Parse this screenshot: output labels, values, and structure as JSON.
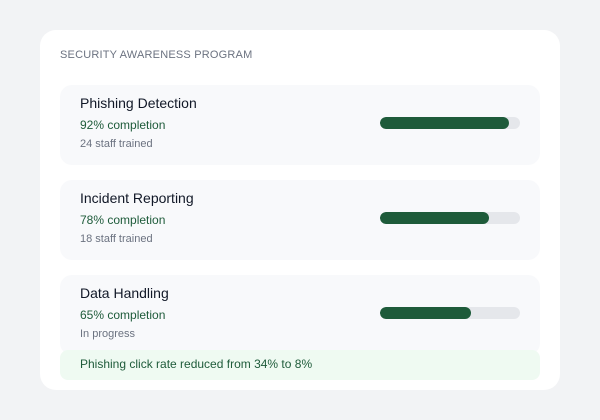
{
  "program": {
    "title": "SECURITY AWARENESS PROGRAM"
  },
  "items": [
    {
      "name": "Phishing Detection",
      "completion_label": "92% completion",
      "meta": "24 staff trained",
      "progress": 0.92
    },
    {
      "name": "Incident Reporting",
      "completion_label": "78% completion",
      "meta": "18 staff trained",
      "progress": 0.78
    },
    {
      "name": "Data Handling",
      "completion_label": "65% completion",
      "meta": "In progress",
      "progress": 0.65
    }
  ],
  "note": {
    "text": "Phishing click rate reduced from 34% to 8%"
  },
  "colors": {
    "accent": "#1e5b3a",
    "track": "#e5e7eb",
    "note_bg": "#effaf2"
  }
}
